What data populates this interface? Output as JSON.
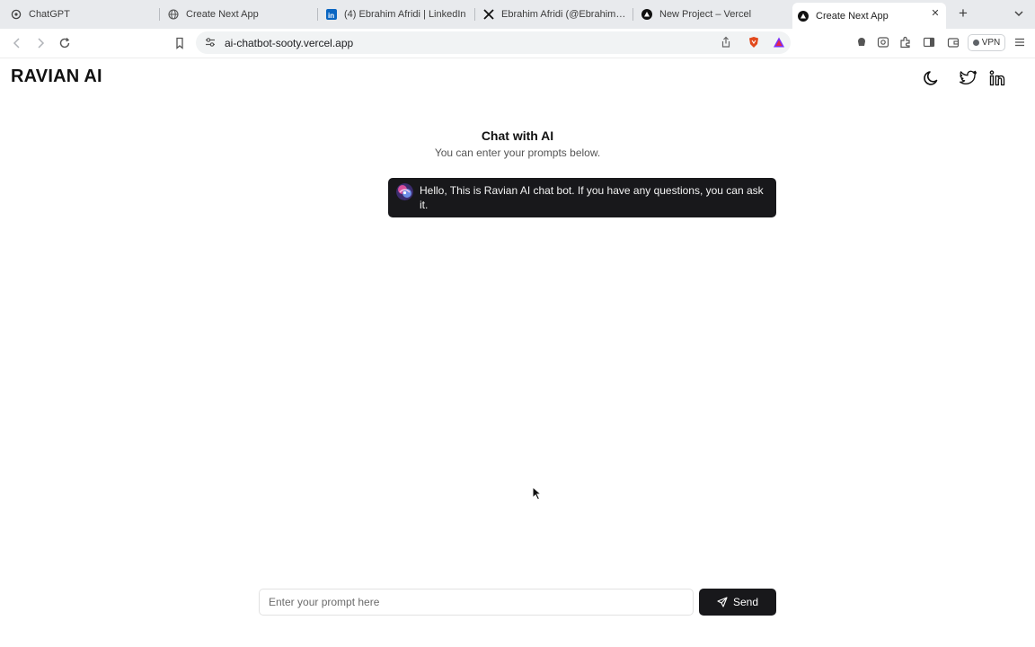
{
  "browser": {
    "tabs": [
      {
        "title": "ChatGPT",
        "icon": "chatgpt-icon",
        "active": false
      },
      {
        "title": "Create Next App",
        "icon": "globe-icon",
        "active": false
      },
      {
        "title": "(4) Ebrahim Afridi | LinkedIn",
        "icon": "linkedin-icon",
        "active": false
      },
      {
        "title": "Ebrahim Afridi (@EbrahimAfridi",
        "icon": "x-icon",
        "active": false
      },
      {
        "title": "New Project – Vercel",
        "icon": "vercel-icon",
        "active": false
      },
      {
        "title": "Create Next App",
        "icon": "vercel-icon",
        "active": true
      }
    ],
    "address": "ai-chatbot-sooty.vercel.app",
    "vpn_label": "VPN"
  },
  "header": {
    "brand": "RAVIAN AI",
    "icons": [
      "moon-icon",
      "twitter-icon",
      "linkedin-icon"
    ]
  },
  "chat": {
    "title": "Chat with AI",
    "subtitle": "You can enter your prompts below.",
    "messages": [
      {
        "role": "bot",
        "text": "Hello, This is Ravian AI chat bot. If you have any questions, you can ask it."
      }
    ]
  },
  "composer": {
    "placeholder": "Enter your prompt here",
    "value": "",
    "send_label": "Send"
  },
  "colors": {
    "primary": "#18181b",
    "background": "#ffffff",
    "tabstrip": "#e8eaed",
    "omnibox": "#f1f3f4"
  }
}
